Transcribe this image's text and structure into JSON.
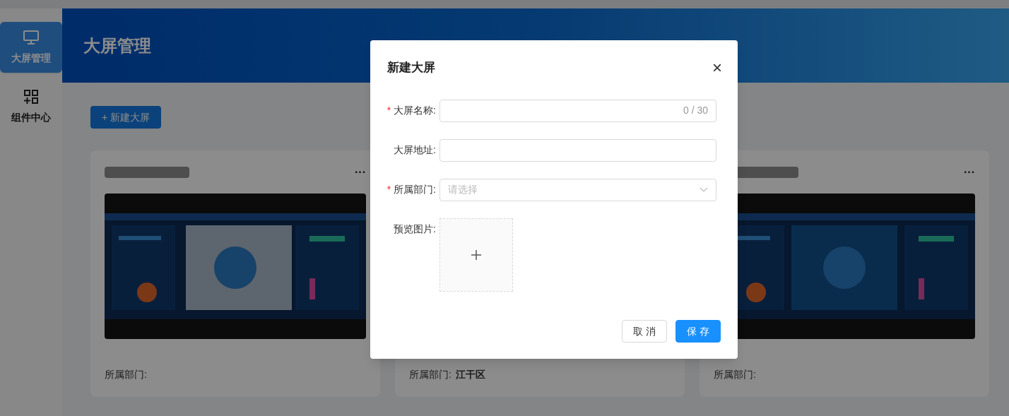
{
  "sidebar": {
    "items": [
      {
        "label": "大屏管理",
        "kind": "monitor",
        "selected": true
      },
      {
        "label": "组件中心",
        "kind": "grid",
        "selected": false
      }
    ]
  },
  "header": {
    "title": "大屏管理"
  },
  "toolbar": {
    "new_button": "+ 新建大屏"
  },
  "cards": [
    {
      "menu": "···",
      "dept_label": "所属部门:"
    },
    {
      "dept_label": "所属部门:",
      "dept_value": "江干区"
    },
    {
      "menu": "···",
      "dept_label": "所属部门:"
    }
  ],
  "dialog": {
    "title": "新建大屏",
    "close": "×",
    "fields": [
      {
        "kind": "text",
        "label": "大屏名称:",
        "required_mark": "*",
        "counter": "0 / 30"
      },
      {
        "kind": "text",
        "label": "大屏地址:"
      },
      {
        "kind": "select",
        "label": "所属部门:",
        "required_mark": "*",
        "placeholder": "请选择"
      },
      {
        "kind": "upload",
        "label": "预览图片:"
      }
    ],
    "buttons": [
      {
        "label": "取 消",
        "kind": "default"
      },
      {
        "label": "保 存",
        "kind": "primary"
      }
    ]
  }
}
